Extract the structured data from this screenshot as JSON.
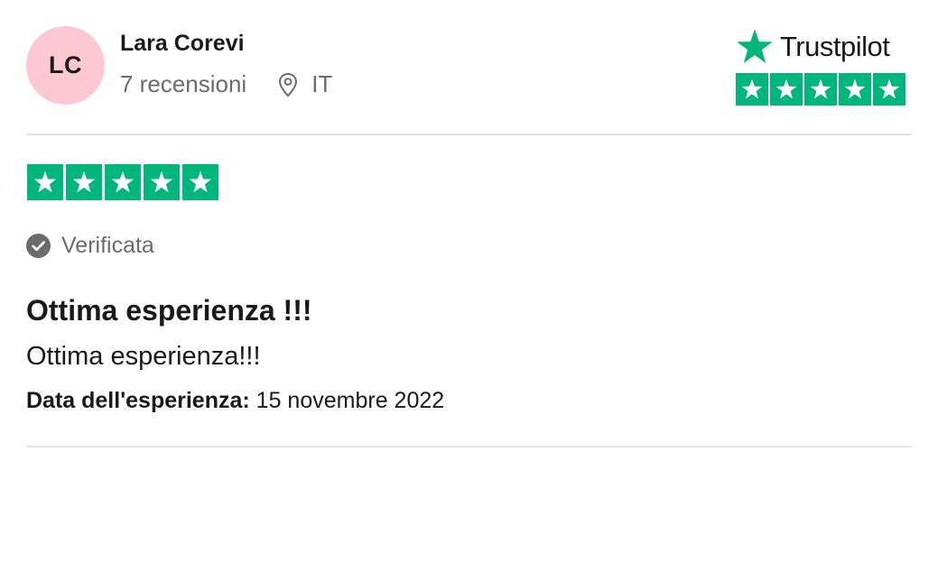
{
  "reviewer": {
    "initials": "LC",
    "avatar_color": "#fdc8d2",
    "name": "Lara Corevi",
    "review_count": "7 recensioni",
    "country": "IT",
    "location_icon": "map-pin-icon"
  },
  "brand": {
    "name": "Trustpilot",
    "logo_icon": "trustpilot-star-icon",
    "accent": "#00b67a",
    "rating": 5,
    "rating_max": 5
  },
  "review": {
    "rating": 5,
    "rating_max": 5,
    "verified_label": "Verificata",
    "verified_icon": "check-circle-icon",
    "title": "Ottima esperienza !!!",
    "body": "Ottima esperienza!!!",
    "date_label": "Data dell'esperienza:",
    "date_value": "15 novembre 2022"
  }
}
